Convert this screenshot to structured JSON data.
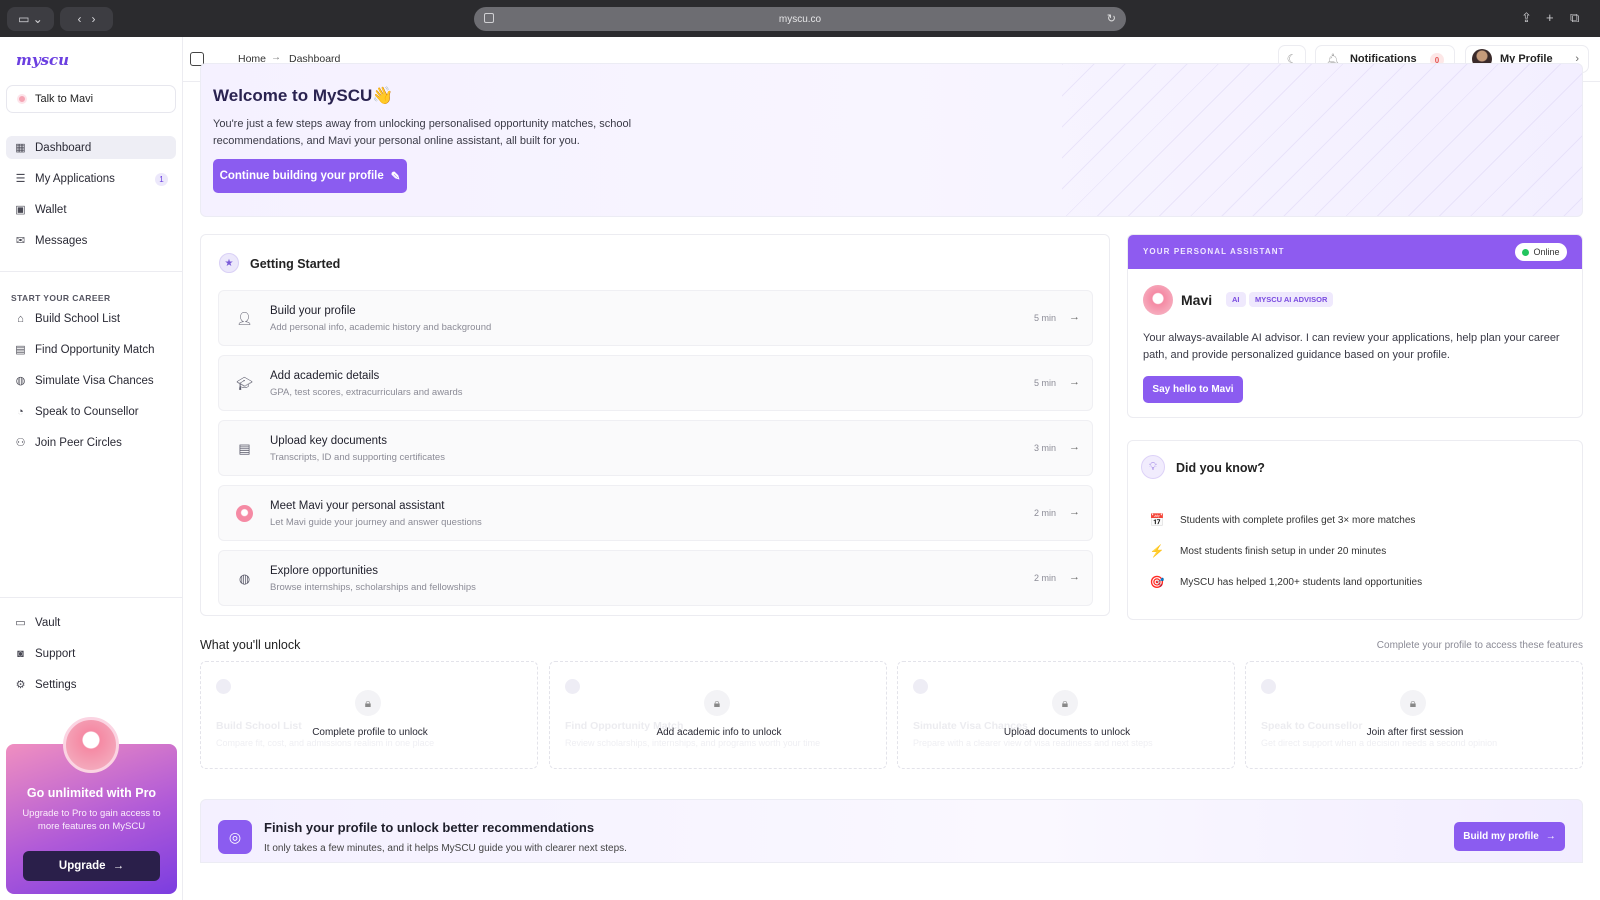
{
  "browser": {
    "url": "myscu.co"
  },
  "sidebar": {
    "logo": "myscu",
    "talk_button": "Talk to Mavi",
    "main_items": [
      {
        "label": "Dashboard",
        "icon": "grid-icon",
        "active": true
      },
      {
        "label": "My Applications",
        "icon": "list-icon",
        "badge": "1"
      },
      {
        "label": "Wallet",
        "icon": "wallet-icon"
      },
      {
        "label": "Messages",
        "icon": "mail-icon"
      }
    ],
    "section_label": "START YOUR CAREER",
    "career_items": [
      {
        "label": "Build School List",
        "icon": "school-icon"
      },
      {
        "label": "Find Opportunity Match",
        "icon": "briefcase-icon"
      },
      {
        "label": "Simulate Visa Chances",
        "icon": "globe-icon"
      },
      {
        "label": "Speak to Counsellor",
        "icon": "chat-icon"
      },
      {
        "label": "Join Peer Circles",
        "icon": "people-icon"
      }
    ],
    "bottom_items": [
      {
        "label": "Vault",
        "icon": "folder-icon"
      },
      {
        "label": "Support",
        "icon": "support-icon"
      },
      {
        "label": "Settings",
        "icon": "gear-icon"
      }
    ],
    "pro_card": {
      "title": "Go unlimited with Pro",
      "description": "Upgrade to Pro to gain access to more features on MySCU",
      "button": "Upgrade"
    }
  },
  "topbar": {
    "breadcrumb": [
      "Home",
      "Dashboard"
    ],
    "notifications_label": "Notifications",
    "notifications_count": "0",
    "profile_label": "My Profile"
  },
  "hero": {
    "title": "Welcome to MySCU👋",
    "description": "You're just a few steps away from unlocking personalised opportunity matches, school recommendations, and Mavi your personal online assistant, all built for you.",
    "button": "Continue building your profile"
  },
  "getting_started": {
    "title": "Getting Started",
    "items": [
      {
        "title": "Build your profile",
        "subtitle": "Add personal info, academic history and background",
        "time": "5 min",
        "icon": "person-icon"
      },
      {
        "title": "Add academic details",
        "subtitle": "GPA, test scores, extracurriculars and awards",
        "time": "5 min",
        "icon": "graduation-cap-icon"
      },
      {
        "title": "Upload key documents",
        "subtitle": "Transcripts, ID and supporting certificates",
        "time": "3 min",
        "icon": "document-icon"
      },
      {
        "title": "Meet Mavi your personal assistant",
        "subtitle": "Let Mavi guide your journey and answer questions",
        "time": "2 min",
        "icon": "mavi-icon"
      },
      {
        "title": "Explore opportunities",
        "subtitle": "Browse internships, scholarships and fellowships",
        "time": "2 min",
        "icon": "globe-icon"
      }
    ]
  },
  "assistant": {
    "header_label": "YOUR PERSONAL ASSISTANT",
    "status": "Online",
    "name": "Mavi",
    "tag_ai": "AI",
    "tag_role": "MYSCU AI ADVISOR",
    "description": "Your always-available AI advisor. I can review your applications, help plan your career path, and provide personalized guidance based on your profile.",
    "button": "Say hello to Mavi"
  },
  "did_you_know": {
    "title": "Did you know?",
    "facts": [
      {
        "icon": "calendar-icon",
        "glyph": "📅",
        "text": "Students with complete profiles get 3× more matches"
      },
      {
        "icon": "lightning-icon",
        "glyph": "⚡",
        "text": "Most students finish setup in under 20 minutes"
      },
      {
        "icon": "target-icon",
        "glyph": "🎯",
        "text": "MySCU has helped 1,200+ students land opportunities"
      }
    ]
  },
  "unlock": {
    "title": "What you'll unlock",
    "note": "Complete your profile to access these features",
    "cards": [
      {
        "ghost_title": "Build School List",
        "ghost_desc": "Compare fit, cost, and admissions realism in one place",
        "lock_label": "Complete profile to unlock"
      },
      {
        "ghost_title": "Find Opportunity Match",
        "ghost_desc": "Review scholarships, internships, and programs worth your time",
        "lock_label": "Add academic info to unlock"
      },
      {
        "ghost_title": "Simulate Visa Chances",
        "ghost_desc": "Prepare with a clearer view of visa readiness and next steps",
        "lock_label": "Upload documents to unlock"
      },
      {
        "ghost_title": "Speak to Counsellor",
        "ghost_desc": "Get direct support when a decision needs a second opinion",
        "lock_label": "Join after first session"
      }
    ]
  },
  "finish": {
    "title": "Finish your profile to unlock better recommendations",
    "description": "It only takes a few minutes, and it helps MySCU guide you with clearer next steps.",
    "button": "Build my profile"
  },
  "colors": {
    "accent": "#8b5cf0",
    "accent_dark": "#6b3fe0",
    "online": "#22c55e"
  }
}
